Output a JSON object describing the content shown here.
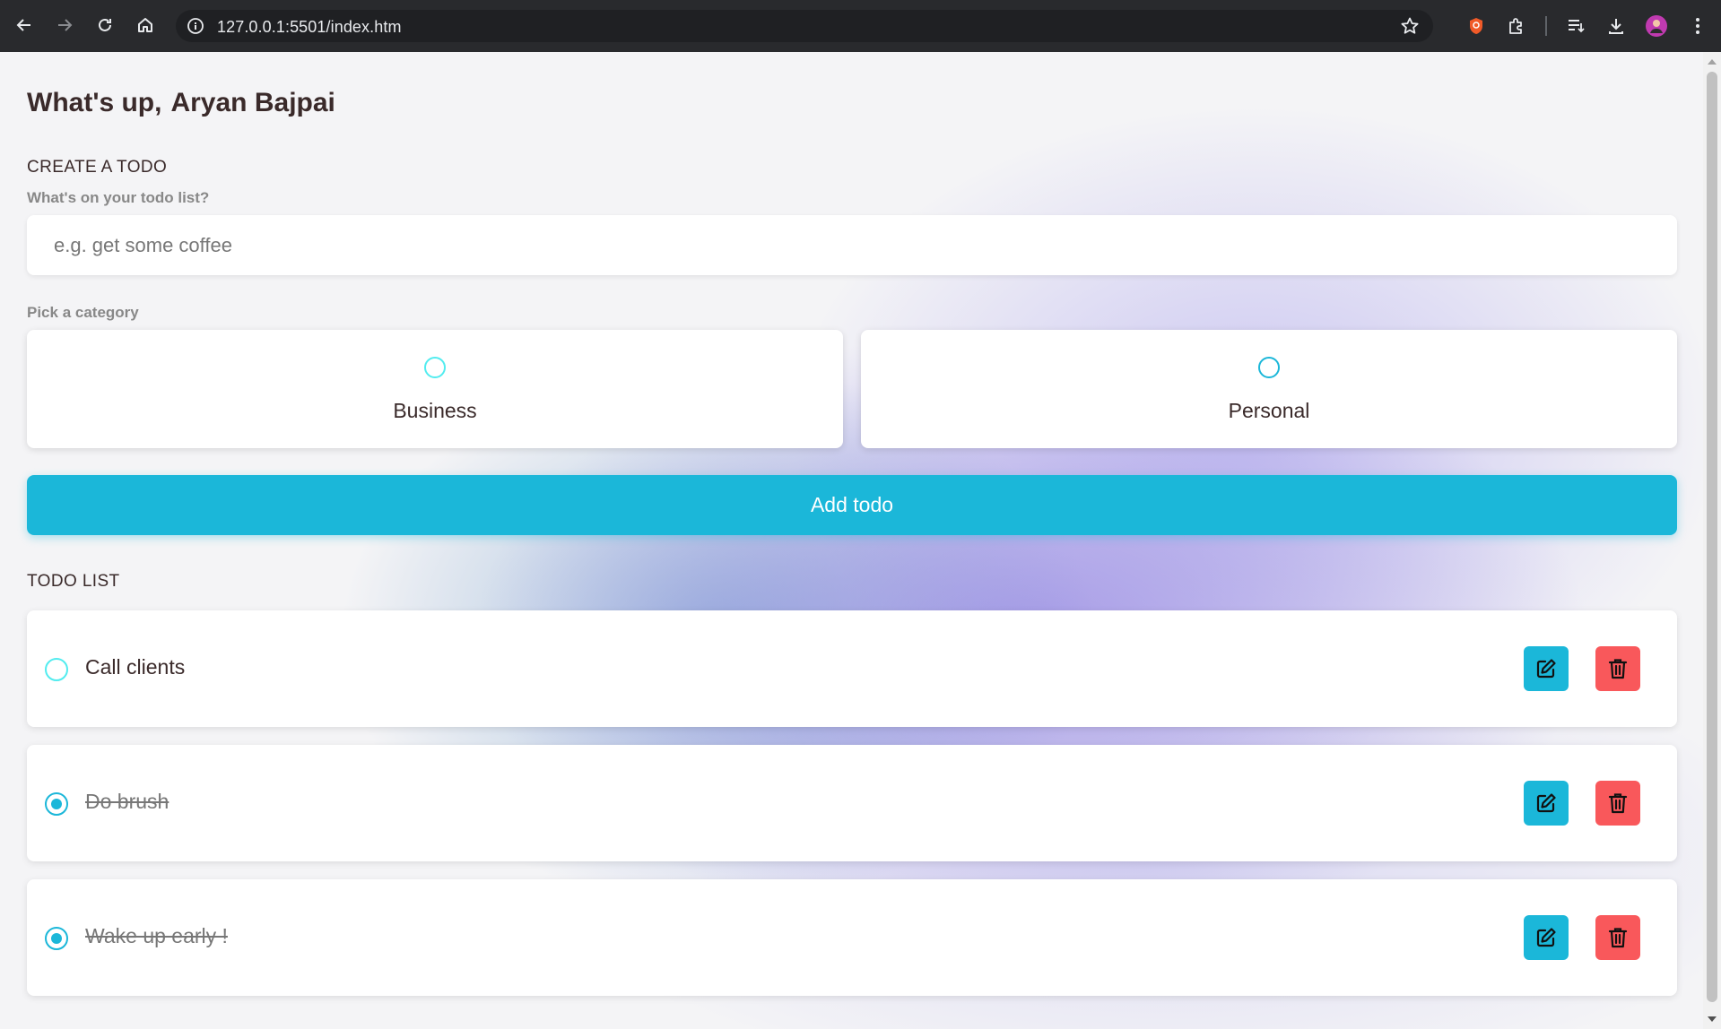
{
  "browser": {
    "url": "127.0.0.1:5501/index.htm"
  },
  "app": {
    "greeting": "What's up,",
    "user_name": "Aryan Bajpai",
    "create_title": "CREATE A TODO",
    "input_label": "What's on your todo list?",
    "input_placeholder": "e.g. get some coffee",
    "input_value": "",
    "category_label": "Pick a category",
    "categories": [
      {
        "label": "Business",
        "color": "#52ecef",
        "selected": false
      },
      {
        "label": "Personal",
        "color": "#1bb7d9",
        "selected": false
      }
    ],
    "add_button": "Add todo",
    "list_title": "TODO LIST",
    "todos": [
      {
        "text": "Call clients",
        "done": false
      },
      {
        "text": "Do brush",
        "done": true
      },
      {
        "text": "Wake up early !",
        "done": true
      }
    ]
  },
  "colors": {
    "accent": "#1bb7d9",
    "business": "#52ecef",
    "delete": "#f9585b",
    "heading": "#3a2a2a"
  },
  "icons": {
    "edit": "pencil-square-icon",
    "delete": "trash-icon"
  }
}
